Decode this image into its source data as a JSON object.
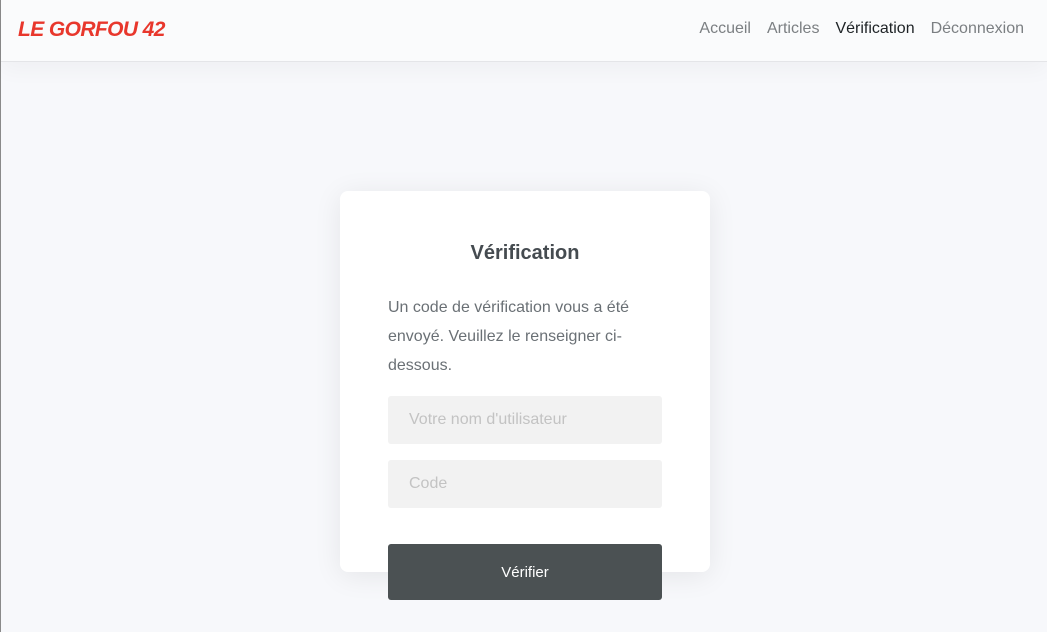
{
  "navbar": {
    "brand": "LE GORFOU 42",
    "links": [
      {
        "label": "Accueil",
        "active": false
      },
      {
        "label": "Articles",
        "active": false
      },
      {
        "label": "Vérification",
        "active": true
      },
      {
        "label": "Déconnexion",
        "active": false
      }
    ]
  },
  "card": {
    "title": "Vérification",
    "message": "Un code de vérification vous a été envoyé. Veuillez le renseigner ci-dessous.",
    "username_placeholder": "Votre nom d'utilisateur",
    "username_value": "",
    "code_placeholder": "Code",
    "code_value": "",
    "submit_label": "Vérifier"
  },
  "colors": {
    "brand": "#e8372c",
    "button": "#4b5153",
    "input_background": "#f2f2f2",
    "page_background": "#f7f8fb"
  }
}
